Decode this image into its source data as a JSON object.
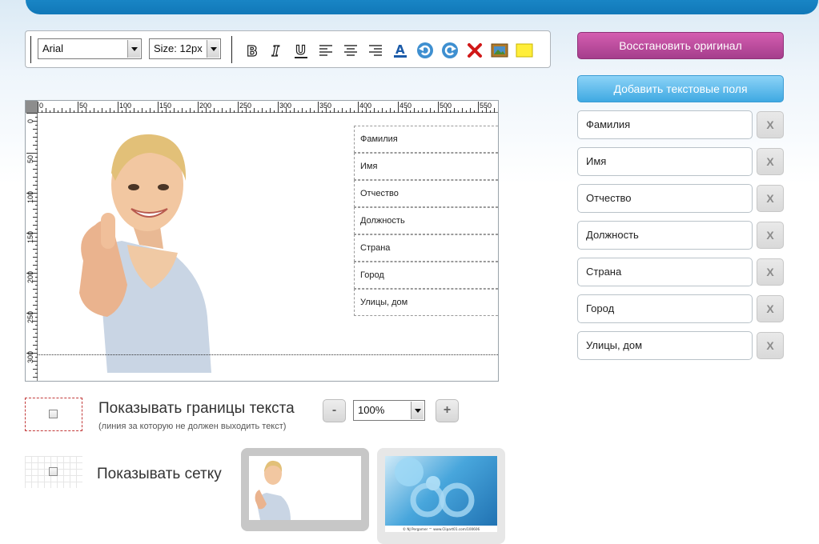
{
  "toolbar": {
    "font_value": "Arial",
    "size_value": "Size: 12px",
    "tools": [
      "bold-icon",
      "italic-icon",
      "underline-icon",
      "align-left-icon",
      "align-center-icon",
      "align-right-icon",
      "text-color-icon",
      "undo-icon",
      "redo-icon",
      "delete-icon",
      "image-icon",
      "background-color-icon"
    ]
  },
  "sidebar": {
    "restore_label": "Восстановить оригинал",
    "add_fields_label": "Добавить текстовые поля",
    "remove_label": "X",
    "fields": [
      "Фамилия",
      "Имя",
      "Отчество",
      "Должность",
      "Страна",
      "Город",
      "Улицы, дом"
    ]
  },
  "canvas": {
    "ruler_h": [
      "0",
      "50",
      "100",
      "150",
      "200",
      "250",
      "300",
      "350",
      "400",
      "450",
      "500",
      "550"
    ],
    "ruler_v": [
      "0",
      "50",
      "100",
      "150",
      "200",
      "250",
      "300"
    ],
    "text_fields": [
      "Фамилия",
      "Имя",
      "Отчество",
      "Должность",
      "Страна",
      "Город",
      "Улицы, дом"
    ]
  },
  "options": {
    "show_bounds_label": "Показывать границы текста",
    "show_bounds_note": "(линия за которую не должен выходить текст)",
    "show_grid_label": "Показывать сетку",
    "zoom_value": "100%",
    "zoom_minus": "-",
    "zoom_plus": "+"
  },
  "thumbnails": {
    "selected_index": 0,
    "second_caption": "© NJ Pergamer ™ www.Clipart01.com/100606"
  },
  "colors": {
    "accent_blue": "#1f8fcf",
    "restore_pink": "#b8489b",
    "add_blue": "#5ab7e8"
  }
}
